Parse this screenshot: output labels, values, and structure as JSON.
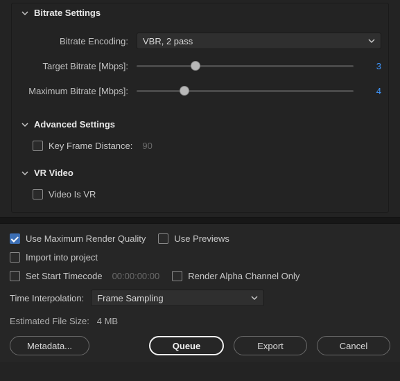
{
  "bitrate": {
    "title": "Bitrate Settings",
    "encoding_label": "Bitrate Encoding:",
    "encoding_value": "VBR, 2 pass",
    "target_label": "Target Bitrate [Mbps]:",
    "target_value": "3",
    "target_pos_pct": 27,
    "maximum_label": "Maximum Bitrate [Mbps]:",
    "maximum_value": "4",
    "maximum_pos_pct": 22
  },
  "advanced": {
    "title": "Advanced Settings",
    "keyframe_label": "Key Frame Distance:",
    "keyframe_value": "90",
    "keyframe_checked": false
  },
  "vr": {
    "title": "VR Video",
    "is_vr_label": "Video Is VR",
    "is_vr_checked": false
  },
  "footer": {
    "max_render_label": "Use Maximum Render Quality",
    "max_render_checked": true,
    "use_previews_label": "Use Previews",
    "use_previews_checked": false,
    "import_label": "Import into project",
    "import_checked": false,
    "set_start_tc_label": "Set Start Timecode",
    "set_start_tc_checked": false,
    "timecode_value": "00:00:00:00",
    "render_alpha_label": "Render Alpha Channel Only",
    "render_alpha_checked": false,
    "time_interp_label": "Time Interpolation:",
    "time_interp_value": "Frame Sampling",
    "est_label": "Estimated File Size:",
    "est_value": "4 MB",
    "metadata_btn": "Metadata...",
    "queue_btn": "Queue",
    "export_btn": "Export",
    "cancel_btn": "Cancel"
  }
}
